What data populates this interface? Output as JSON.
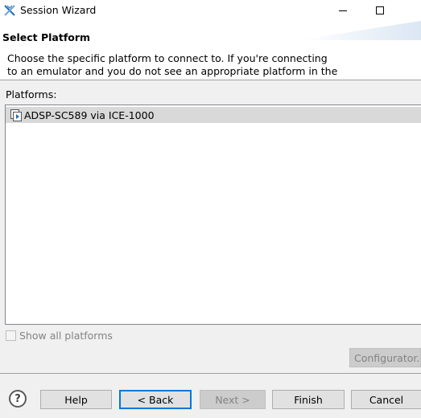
{
  "window": {
    "title": "Session Wizard",
    "icon": "x-icon",
    "controls": {
      "minimize": "minimize-icon",
      "maximize": "maximize-icon"
    }
  },
  "header": {
    "title": "Select Platform",
    "description": "Choose the specific platform to connect to.  If you're connecting\nto an emulator and you do not see an appropriate platform in the"
  },
  "platforms": {
    "label": "Platforms:",
    "items": [
      {
        "label": "ADSP-SC589 via ICE-1000",
        "icon": "platform-icon",
        "selected": true
      }
    ]
  },
  "show_all": {
    "label": "Show all platforms",
    "checked": false,
    "enabled": false
  },
  "configurator": {
    "label": "Configurator...",
    "enabled": false
  },
  "footer": {
    "help_icon": "?",
    "help": "Help",
    "back": "< Back",
    "next": "Next >",
    "finish": "Finish",
    "cancel": "Cancel"
  },
  "colors": {
    "selection": "#d9d9d9",
    "focus_border": "#0078d7",
    "disabled_text": "#838383",
    "icon_blue": "#1e6fb8"
  }
}
